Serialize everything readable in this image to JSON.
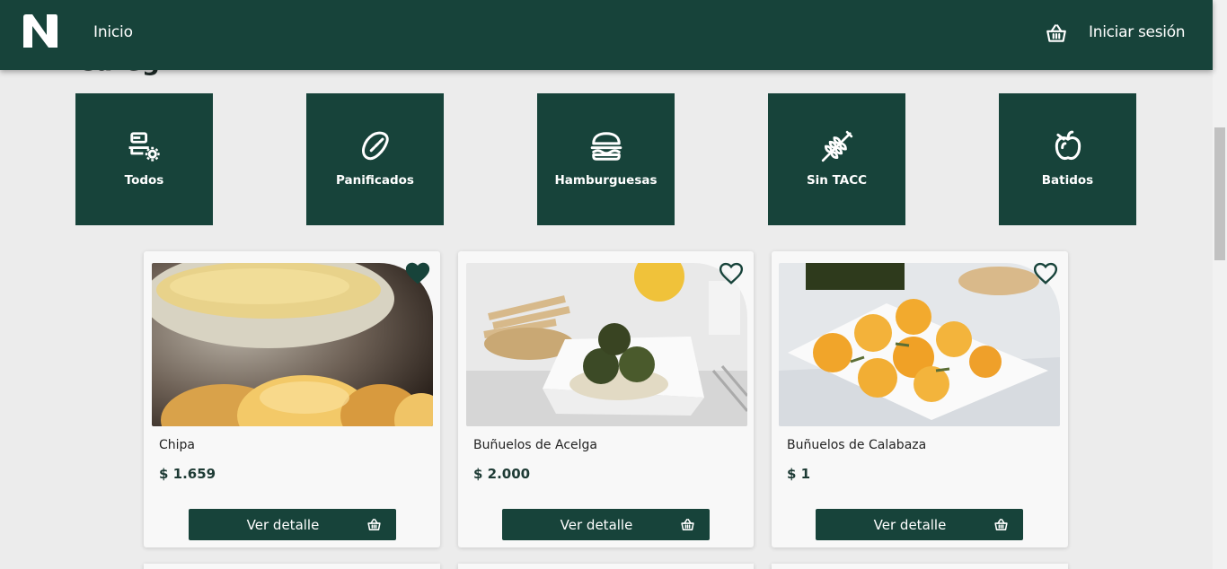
{
  "header": {
    "nav_home": "Inicio",
    "login": "Iniciar sesión",
    "bg_color": "#17433a"
  },
  "page_heading_peek": "Categ",
  "categories": [
    {
      "label": "Todos",
      "icon": "all-items-icon"
    },
    {
      "label": "Panificados",
      "icon": "bread-icon"
    },
    {
      "label": "Hamburguesas",
      "icon": "burger-icon"
    },
    {
      "label": "Sin TACC",
      "icon": "wheat-icon"
    },
    {
      "label": "Batidos",
      "icon": "apple-icon"
    }
  ],
  "products": [
    {
      "name": "Chipa",
      "price": "$ 1.659",
      "favorite": true,
      "button": "Ver detalle"
    },
    {
      "name": "Buñuelos de Acelga",
      "price": "$ 2.000",
      "favorite": false,
      "button": "Ver detalle"
    },
    {
      "name": "Buñuelos de Calabaza",
      "price": "$ 1",
      "favorite": false,
      "button": "Ver detalle"
    }
  ],
  "colors": {
    "primary": "#17433a",
    "background": "#ececec",
    "card": "#f8f8f8"
  }
}
